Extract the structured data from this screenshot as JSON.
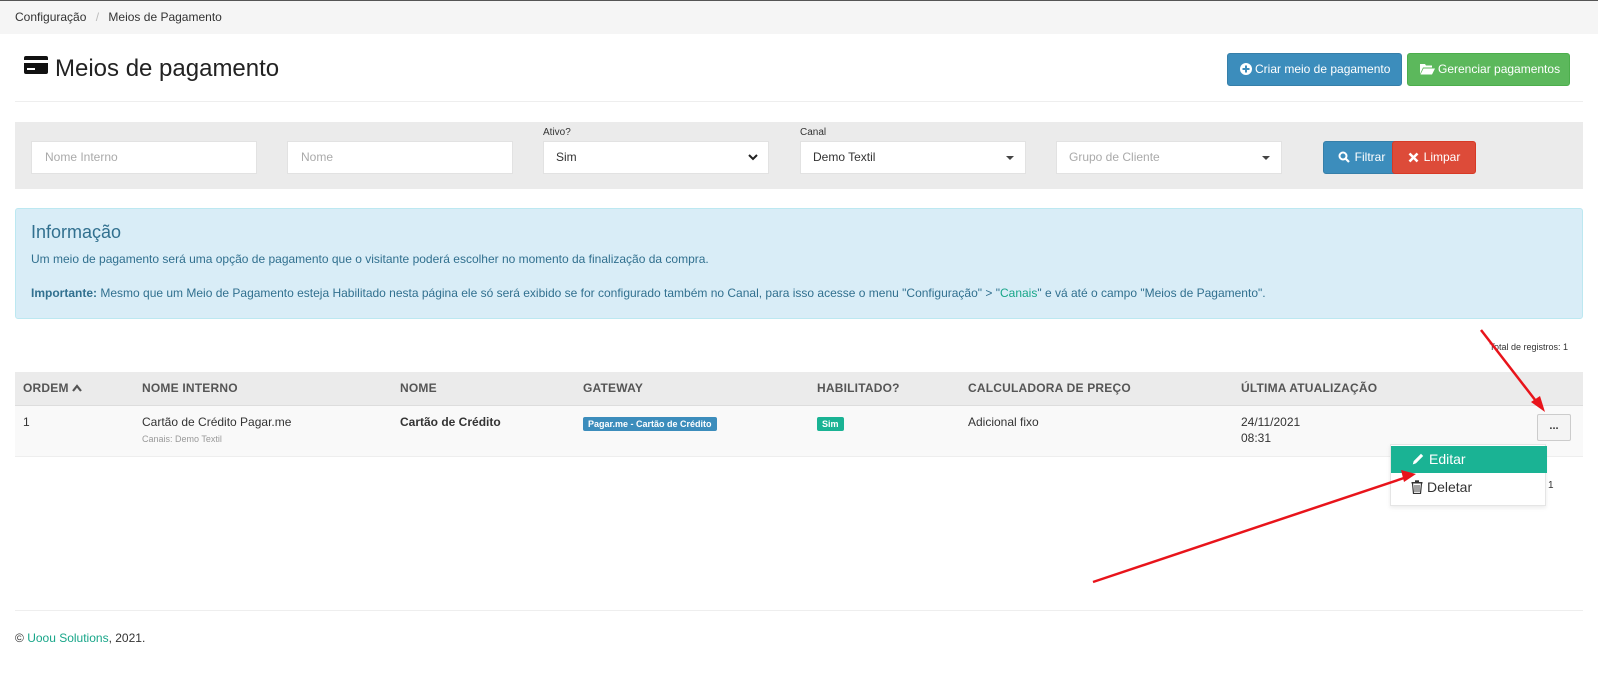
{
  "breadcrumb": {
    "items": [
      "Configuração",
      "Meios de Pagamento"
    ],
    "separator": "/"
  },
  "header": {
    "title": "Meios de pagamento",
    "icon": "credit-card-icon",
    "create_button": "Criar meio de pagamento",
    "manage_button": "Gerenciar pagamentos"
  },
  "filters": {
    "internal_name_placeholder": "Nome Interno",
    "name_placeholder": "Nome",
    "active_label": "Ativo?",
    "active_value": "Sim",
    "channel_label": "Canal",
    "channel_value": "Demo Textil",
    "customer_group_placeholder": "Grupo de Cliente",
    "filter_button": "Filtrar",
    "clear_button": "Limpar"
  },
  "info": {
    "title": "Informação",
    "text1": "Um meio de pagamento será uma opção de pagamento que o visitante poderá escolher no momento da finalização da compra.",
    "important_label": "Importante:",
    "text2_part1": "Mesmo que um Meio de Pagamento esteja Habilitado nesta página ele só será exibido se for configurado também no Canal, para isso acesse o menu \"Configuração\" > \"",
    "text2_link": "Canais",
    "text2_part2": "\" e vá até o campo \"Meios de Pagamento\"."
  },
  "total_records": "Total de registros: 1",
  "table": {
    "headers": [
      "ORDEM",
      "NOME INTERNO",
      "NOME",
      "GATEWAY",
      "HABILITADO?",
      "CALCULADORA DE PREÇO",
      "ÚLTIMA ATUALIZAÇÃO"
    ],
    "rows": [
      {
        "order": "1",
        "internal_name": "Cartão de Crédito Pagar.me",
        "channels": "Canais: Demo Textil",
        "name": "Cartão de Crédito",
        "gateway": "Pagar.me - Cartão de Crédito",
        "enabled": "Sim",
        "price_calculator": "Adicional fixo",
        "updated_date": "24/11/2021",
        "updated_time": "08:31",
        "actions": "..."
      }
    ]
  },
  "dropdown": {
    "edit": "Editar",
    "delete": "Deletar",
    "side_count": "1"
  },
  "footer": {
    "copyright": "©",
    "company": "Uoou Solutions",
    "year": ", 2021."
  },
  "colors": {
    "primary": "#3c8dbc",
    "success": "#5cb85c",
    "danger": "#dd4b39",
    "teal": "#1ab394",
    "info_bg": "#d9edf7",
    "arrow": "#e8141b"
  }
}
